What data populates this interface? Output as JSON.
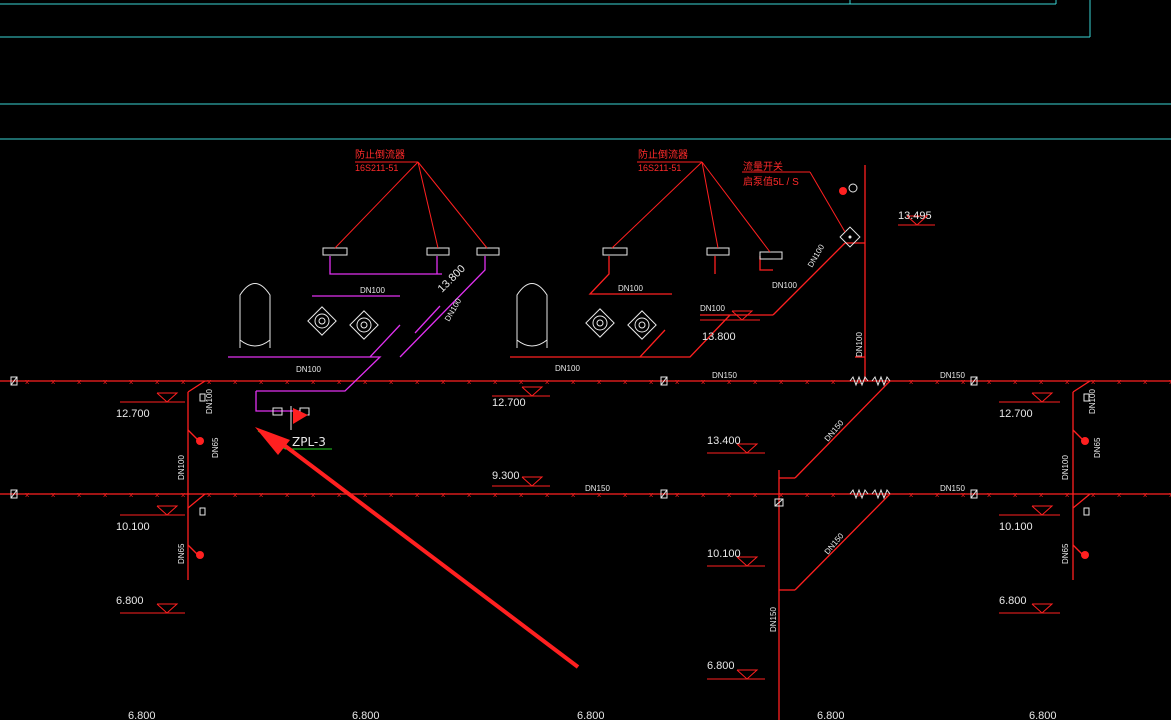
{
  "annotations": {
    "backflow_left": {
      "title": "防止倒流器",
      "code": "16S211-51"
    },
    "backflow_mid": {
      "title": "防止倒流器",
      "code": "16S211-51"
    },
    "flow_switch": {
      "title": "流量开关",
      "spec": "启泵值5L / S"
    }
  },
  "zone_label": "ZPL-3",
  "elevations": {
    "e13_495": "13.495",
    "e13_800_rot": "13.800",
    "e13_800": "13.800",
    "e13_400": "13.400",
    "e12_700_l": "12.700",
    "e12_700_m": "12.700",
    "e12_700_r": "12.700",
    "e10_100_l": "10.100",
    "e10_100_m": "10.100",
    "e10_100_r": "10.100",
    "e9_300": "9.300",
    "e6_800_l": "6.800",
    "e6_800_m": "6.800",
    "e6_800_r": "6.800",
    "b1": "6.800",
    "b2": "6.800",
    "b3": "6.800",
    "b4": "6.800",
    "b5": "6.800"
  },
  "dn": {
    "dn100_a": "DN100",
    "dn100_b": "DN100",
    "dn100_c": "DN100",
    "dn100_d": "DN100",
    "dn100_e": "DN100",
    "dn100_f": "DN100",
    "dn100_g": "DN100",
    "dn100_h": "DN100",
    "dn100_v": "DN100",
    "dn100_l1": "DN100",
    "dn100_l2": "DN100",
    "dn100_r1": "DN100",
    "dn100_r2": "DN100",
    "dn150_a": "DN150",
    "dn150_b": "DN150",
    "dn150_c": "DN150",
    "dn150_d": "DN150",
    "dn150_e": "DN150",
    "dn150_f": "DN150",
    "dn150_v": "DN150",
    "dn65_l1": "DN65",
    "dn65_l2": "DN65",
    "dn65_r1": "DN65",
    "dn65_r2": "DN65"
  },
  "colors": {
    "background": "#000000",
    "frame": "#3ad4d4",
    "pipe_red": "#ff2020",
    "pipe_magenta": "#e030f0",
    "text": "#e8e8e8",
    "arrow": "#ff2020",
    "flag": "#ff2020",
    "zone_line": "#20d020"
  }
}
